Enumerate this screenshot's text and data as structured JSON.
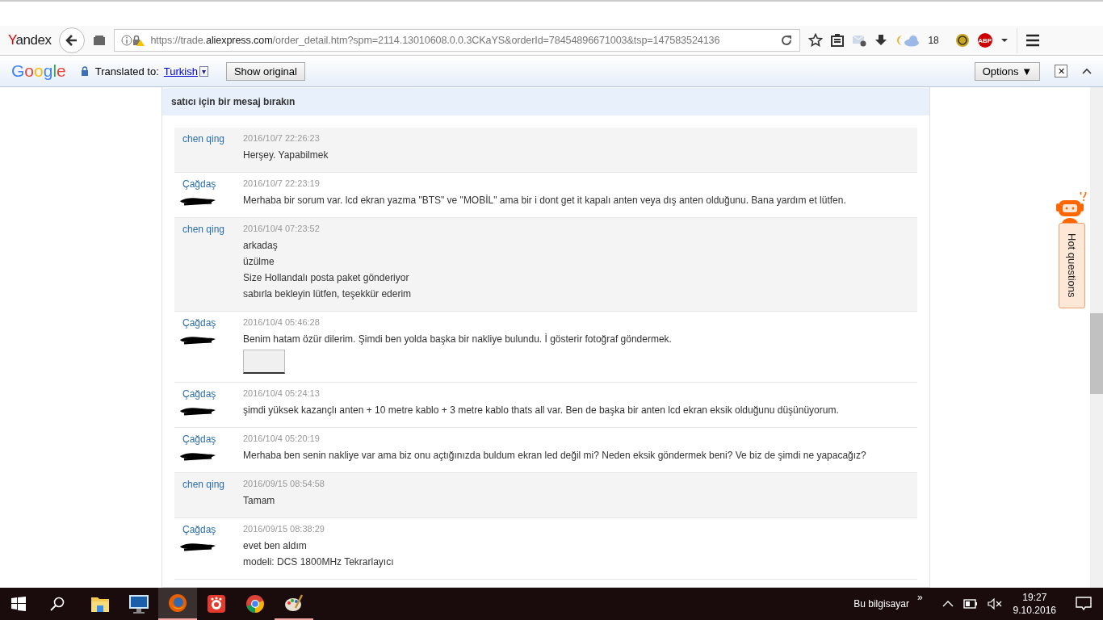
{
  "browser": {
    "brand": "Yandex",
    "url_prefix": "https://trade.",
    "url_domain": "aliexpress.com",
    "url_rest": "/order_detail.htm?spm=2114.13010608.0.0.3CKaYS&orderId=78454896671003&tsp=147583524136",
    "weather_temp": "18",
    "abp_label": "ABP"
  },
  "translate_bar": {
    "brand_letters": [
      {
        "char": "G",
        "color": "#4285f4"
      },
      {
        "char": "o",
        "color": "#ea4335"
      },
      {
        "char": "o",
        "color": "#fbbc05"
      },
      {
        "char": "g",
        "color": "#4285f4"
      },
      {
        "char": "l",
        "color": "#34a853"
      },
      {
        "char": "e",
        "color": "#ea4335"
      }
    ],
    "label": "Translated to:",
    "language": "Turkish",
    "dropdown_glyph": "▾",
    "show_original": "Show original",
    "options": "Options ▼",
    "close_glyph": "✕"
  },
  "panel": {
    "title": "satıcı için bir mesaj bırakın"
  },
  "messages": [
    {
      "kind": "seller",
      "sender": "chen qing",
      "time": "2016/10/7 22:26:23",
      "lines": [
        "Herşey. Yapabilmek"
      ],
      "redacted": false,
      "attachment": false
    },
    {
      "kind": "buyer",
      "sender": "Çağdaş",
      "time": "2016/10/7 22:23:19",
      "lines": [
        "Merhaba bir sorum var. lcd ekran yazma \"BTS\" ve \"MOBİL\" ama bir i dont get it kapalı anten veya dış anten olduğunu. Bana yardım et lütfen."
      ],
      "redacted": true,
      "attachment": false
    },
    {
      "kind": "seller",
      "sender": "chen qing",
      "time": "2016/10/4 07:23:52",
      "lines": [
        "arkadaş",
        "üzülme",
        "Size Hollandalı posta paket gönderiyor",
        "sabırla bekleyin lütfen, teşekkür ederim"
      ],
      "redacted": false,
      "attachment": false
    },
    {
      "kind": "buyer",
      "sender": "Çağdaş",
      "time": "2016/10/4 05:46:28",
      "lines": [
        "Benim hatam özür dilerim. Şimdi ben yolda başka bir nakliye bulundu. İ gösterir fotoğraf göndermek."
      ],
      "redacted": true,
      "attachment": true
    },
    {
      "kind": "buyer",
      "sender": "Çağdaş",
      "time": "2016/10/4 05:24:13",
      "lines": [
        "şimdi yüksek kazançlı anten + 10 metre kablo + 3 metre kablo thats all var. Ben de başka bir anten lcd ekran eksik olduğunu düşünüyorum."
      ],
      "redacted": true,
      "attachment": false
    },
    {
      "kind": "buyer",
      "sender": "Çağdaş",
      "time": "2016/10/4 05:20:19",
      "lines": [
        "Merhaba ben senin nakliye var ama biz onu açtığınızda buldum ekran led değil mi? Neden eksik göndermek beni? Ve biz de şimdi ne yapacağız?"
      ],
      "redacted": true,
      "attachment": false
    },
    {
      "kind": "seller",
      "sender": "chen qing",
      "time": "2016/09/15 08:54:58",
      "lines": [
        "Tamam"
      ],
      "redacted": false,
      "attachment": false
    },
    {
      "kind": "buyer",
      "sender": "Çağdaş",
      "time": "2016/09/15 08:38:29",
      "lines": [
        "evet ben aldım",
        "modeli: DCS 1800MHz Tekrarlayıcı"
      ],
      "redacted": true,
      "attachment": false
    }
  ],
  "help_widget": {
    "label": "Hot questions"
  },
  "taskbar": {
    "apps": [
      {
        "kind": "explorer",
        "selected": false,
        "running": false
      },
      {
        "kind": "monitor",
        "selected": false,
        "running": false
      },
      {
        "kind": "firefox",
        "selected": true,
        "running": true
      },
      {
        "kind": "recorder",
        "selected": false,
        "running": false
      },
      {
        "kind": "chrome",
        "selected": false,
        "running": false
      },
      {
        "kind": "paint",
        "selected": false,
        "running": true
      }
    ],
    "toolbar_label": "Bu bilgisayar",
    "toolbar_glyph": "»",
    "time": "19:27",
    "date": "9.10.2016"
  }
}
